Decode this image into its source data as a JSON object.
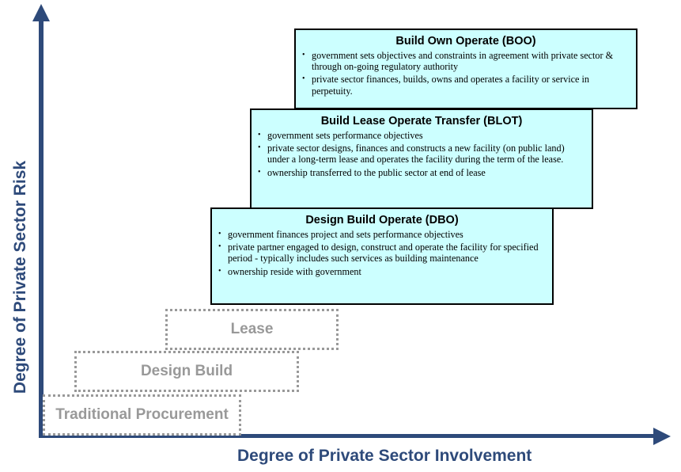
{
  "axes": {
    "y_label": "Degree of Private Sector Risk",
    "x_label": "Degree of Private Sector Involvement",
    "color": "#2e4a7a"
  },
  "models": [
    {
      "id": "boo",
      "title": "Build Own Operate (BOO)",
      "bullets": [
        "government sets objectives and constraints in agreement with private sector & through on-going regulatory authority",
        "private sector finances, builds, owns and operates a facility or service in perpetuity."
      ]
    },
    {
      "id": "blot",
      "title": "Build Lease Operate Transfer (BLOT)",
      "bullets": [
        "government sets performance objectives",
        "private sector designs, finances and constructs a new facility (on public land) under a long-term lease and operates the facility during the term of the  lease.",
        "ownership transferred to the public sector at end of lease"
      ]
    },
    {
      "id": "dbo",
      "title": "Design Build Operate (DBO)",
      "bullets": [
        "government finances project and sets performance  objectives",
        "private partner engaged to design, construct and operate the facility for specified period - typically includes such services as building maintenance",
        "ownership reside with  government"
      ]
    }
  ],
  "traditional_models": [
    {
      "label": "Lease"
    },
    {
      "label": "Design Build"
    },
    {
      "label": "Traditional Procurement"
    }
  ],
  "colors": {
    "highlight_fill": "#ccffff",
    "dashed_gray": "#999999"
  }
}
